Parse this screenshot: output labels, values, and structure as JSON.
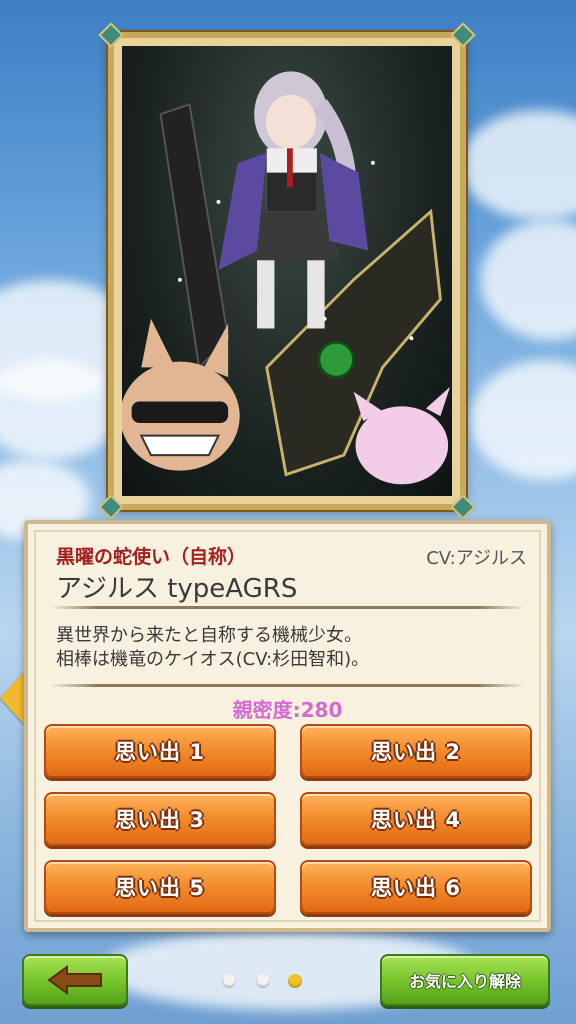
{
  "character": {
    "title": "黒曜の蛇使い（自称）",
    "cv": "CV:アジルス",
    "name": "アジルス typeAGRS",
    "description": [
      "異世界から来たと自称する機械少女。",
      "相棒は機竜のケイオス(CV:杉田智和)。"
    ],
    "intimacy": "親密度:280"
  },
  "memories": [
    {
      "label": "思い出 1"
    },
    {
      "label": "思い出 2"
    },
    {
      "label": "思い出 3"
    },
    {
      "label": "思い出 4"
    },
    {
      "label": "思い出 5"
    },
    {
      "label": "思い出 6"
    }
  ],
  "footer": {
    "favorite_button": "お気に入り解除",
    "page_count": 3,
    "active_page": 3
  },
  "colors": {
    "accent_orange": "#f28a2a",
    "title_red": "#a32020",
    "intimacy_pink": "#d46ad4",
    "green_button": "#74c22a",
    "dot_active": "#f2c12a",
    "dot_inactive": "#f2f2f2"
  },
  "icons": {
    "back": "left-arrow-icon",
    "prev_card": "caret-left-icon"
  }
}
